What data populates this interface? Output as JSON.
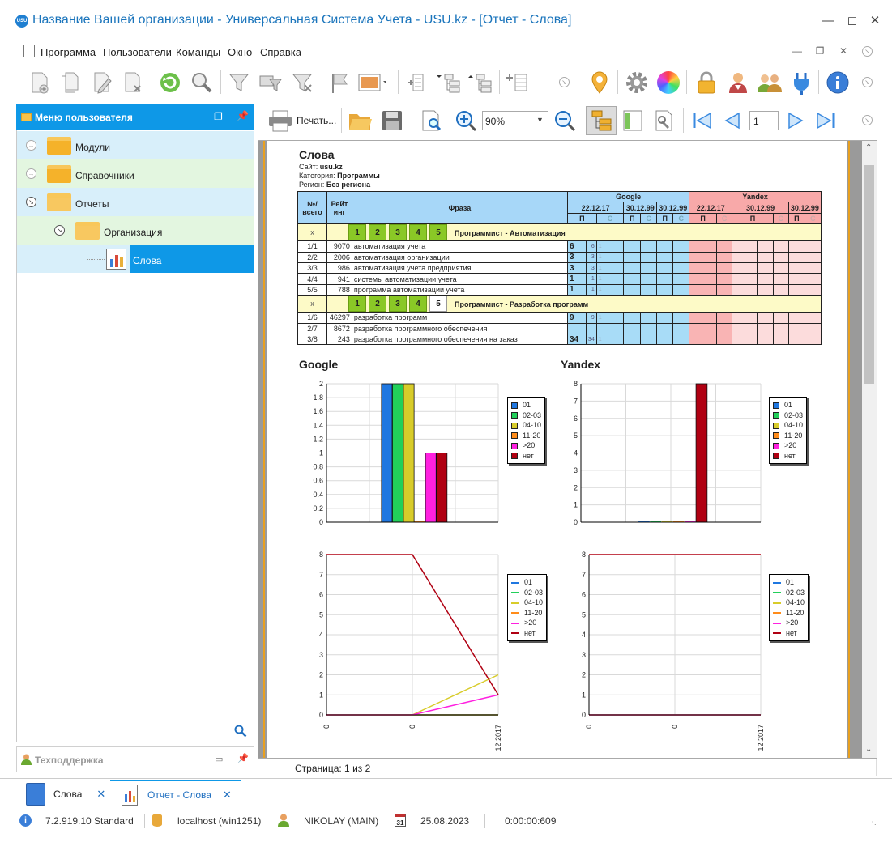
{
  "window": {
    "title": "Название Вашей организации - Универсальная Система Учета - USU.kz - [Отчет - Слова]",
    "logo": "USU"
  },
  "menu": [
    "Программа",
    "Пользователи",
    "Команды",
    "Окно",
    "Справка"
  ],
  "side_panel": {
    "title": "Меню пользователя",
    "items": [
      {
        "label": "Модули"
      },
      {
        "label": "Справочники"
      },
      {
        "label": "Отчеты"
      },
      {
        "label": "Организация"
      },
      {
        "label": "Слова"
      }
    ],
    "support": "Техподдержка"
  },
  "report_toolbar": {
    "print_label": "Печать...",
    "zoom": "90%",
    "page": "1"
  },
  "report": {
    "title": "Слова",
    "site_label": "Сайт:",
    "site": "usu.kz",
    "category_label": "Категория:",
    "category": "Программы",
    "region_label": "Регион:",
    "region": "Без региона",
    "head": {
      "no": "№/ всего",
      "rating": "Рейт инг",
      "phrase": "Фраза",
      "google": "Google",
      "yandex": "Yandex",
      "dates": [
        "22.12.17",
        "30.12.99",
        "30.12.99"
      ],
      "p": "П",
      "s": "С"
    },
    "groups": [
      {
        "x": "x",
        "boxes": [
          "1",
          "2",
          "3",
          "4",
          "5"
        ],
        "name": "Программист - Автоматизация",
        "rows": [
          {
            "no": "1/1",
            "rating": "9070",
            "phrase": "автоматизация учета",
            "p": "6",
            "s": "6",
            "c": "1"
          },
          {
            "no": "2/2",
            "rating": "2006",
            "phrase": "автоматизация организации",
            "p": "3",
            "s": "3",
            "c": "1"
          },
          {
            "no": "3/3",
            "rating": "986",
            "phrase": "автоматизация учета предприятия",
            "p": "3",
            "s": "3",
            "c": "1"
          },
          {
            "no": "4/4",
            "rating": "941",
            "phrase": "системы автоматизации учета",
            "p": "1",
            "s": "1",
            "c": "1"
          },
          {
            "no": "5/5",
            "rating": "788",
            "phrase": "программа автоматизации учета",
            "p": "1",
            "s": "1",
            "c": "1"
          }
        ]
      },
      {
        "x": "x",
        "boxes": [
          "1",
          "2",
          "3",
          "4",
          "5"
        ],
        "name": "Программист - Разработка программ",
        "rows": [
          {
            "no": "1/6",
            "rating": "46297",
            "phrase": "разработка программ",
            "p": "9",
            "s": "9",
            "c": "1"
          },
          {
            "no": "2/7",
            "rating": "8672",
            "phrase": "разработка программного обеспечения",
            "p": "",
            "s": "",
            "c": ""
          },
          {
            "no": "3/8",
            "rating": "243",
            "phrase": "разработка программного обеспечения на заказ",
            "p": "34",
            "s": "34",
            "c": "1"
          }
        ]
      }
    ],
    "chart_titles": {
      "google": "Google",
      "yandex": "Yandex"
    }
  },
  "chart_data": [
    {
      "type": "bar",
      "title": "Google",
      "categories": [
        "01",
        "02-03",
        "04-10",
        "11-20",
        ">20",
        "нет"
      ],
      "values": [
        2,
        2,
        2,
        0,
        1,
        1
      ],
      "colors": [
        "#1f77e0",
        "#22d05a",
        "#d8cc2a",
        "#ff8c1a",
        "#ff20e0",
        "#b00012"
      ],
      "ylim": [
        0,
        2
      ],
      "yticks": [
        "0",
        "0.2",
        "0.4",
        "0.6",
        "0.8",
        "1",
        "1.2",
        "1.4",
        "1.6",
        "1.8",
        "2"
      ]
    },
    {
      "type": "bar",
      "title": "Yandex",
      "categories": [
        "01",
        "02-03",
        "04-10",
        "11-20",
        ">20",
        "нет"
      ],
      "values": [
        0,
        0,
        0,
        0,
        0,
        8
      ],
      "colors": [
        "#1f77e0",
        "#22d05a",
        "#d8cc2a",
        "#ff8c1a",
        "#ff20e0",
        "#b00012"
      ],
      "ylim": [
        0,
        8
      ],
      "yticks": [
        "0",
        "1",
        "2",
        "3",
        "4",
        "5",
        "6",
        "7",
        "8"
      ]
    },
    {
      "type": "line",
      "x": [
        "0",
        "0",
        "12.2017"
      ],
      "series": [
        {
          "name": "01",
          "values": [
            0,
            0,
            0
          ],
          "color": "#1f77e0"
        },
        {
          "name": "02-03",
          "values": [
            0,
            0,
            0
          ],
          "color": "#22d05a"
        },
        {
          "name": "04-10",
          "values": [
            0,
            0,
            2
          ],
          "color": "#d8cc2a"
        },
        {
          "name": "11-20",
          "values": [
            0,
            0,
            0
          ],
          "color": "#ff8c1a"
        },
        {
          "name": ">20",
          "values": [
            0,
            0,
            1
          ],
          "color": "#ff20e0"
        },
        {
          "name": "нет",
          "values": [
            8,
            8,
            1
          ],
          "color": "#b00012"
        }
      ],
      "ylim": [
        0,
        8
      ],
      "yticks": [
        "0",
        "1",
        "2",
        "3",
        "4",
        "5",
        "6",
        "7",
        "8"
      ]
    },
    {
      "type": "line",
      "x": [
        "0",
        "0",
        "12.2017"
      ],
      "series": [
        {
          "name": "01",
          "values": [
            0,
            0,
            0
          ],
          "color": "#1f77e0"
        },
        {
          "name": "02-03",
          "values": [
            0,
            0,
            0
          ],
          "color": "#22d05a"
        },
        {
          "name": "04-10",
          "values": [
            0,
            0,
            0
          ],
          "color": "#d8cc2a"
        },
        {
          "name": "11-20",
          "values": [
            0,
            0,
            0
          ],
          "color": "#ff8c1a"
        },
        {
          "name": ">20",
          "values": [
            0,
            0,
            0
          ],
          "color": "#ff20e0"
        },
        {
          "name": "нет",
          "values": [
            8,
            8,
            8
          ],
          "color": "#b00012"
        }
      ],
      "ylim": [
        0,
        8
      ],
      "yticks": [
        "0",
        "1",
        "2",
        "3",
        "4",
        "5",
        "6",
        "7",
        "8"
      ]
    }
  ],
  "page_status": "Страница: 1 из 2",
  "tabs": [
    {
      "label": "Слова"
    },
    {
      "label": "Отчет - Слова"
    }
  ],
  "statusbar": {
    "version": "7.2.919.10 Standard",
    "db": "localhost (win1251)",
    "user": "NIKOLAY (MAIN)",
    "date": "25.08.2023",
    "timer": "0:00:00:609",
    "calendar_day": "31"
  }
}
